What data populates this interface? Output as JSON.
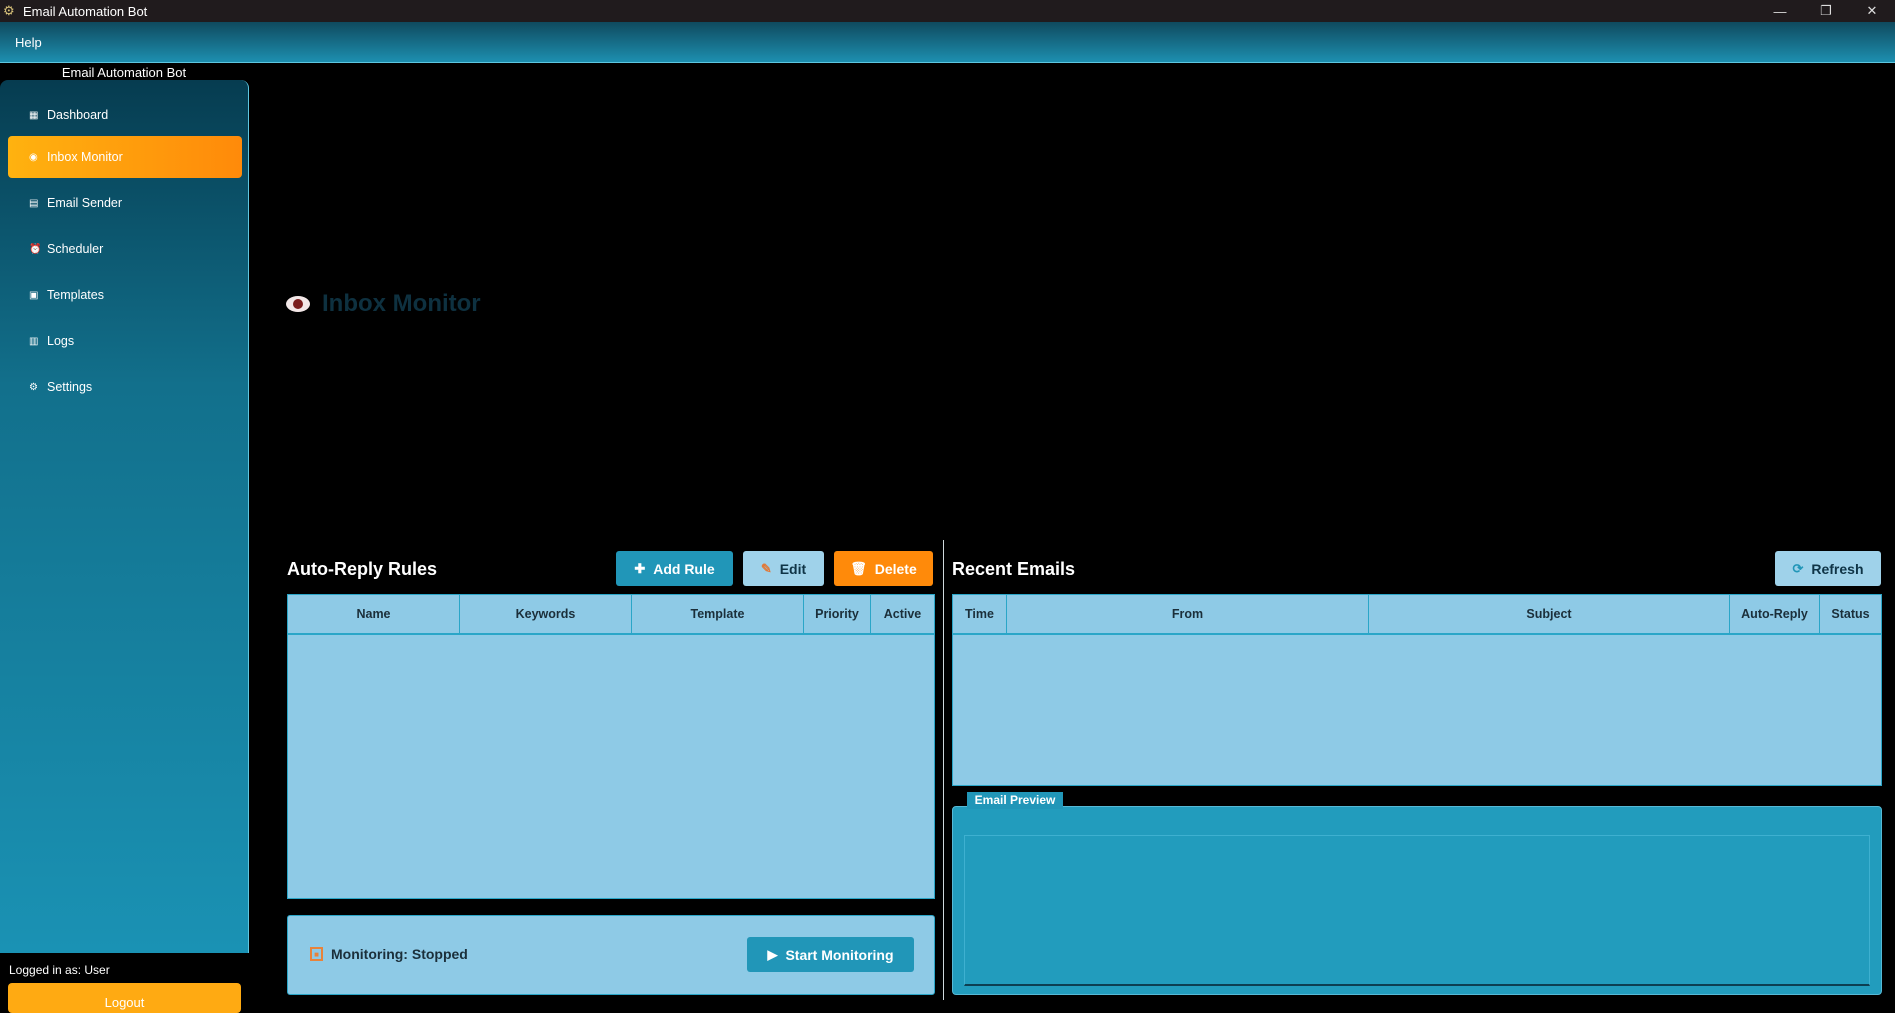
{
  "window": {
    "title": "Email Automation Bot",
    "controls": {
      "minimize": "—",
      "maximize": "❐",
      "close": "✕"
    }
  },
  "menubar": {
    "help": "Help"
  },
  "sidebar": {
    "title": "Email Automation Bot",
    "items": [
      {
        "label": "Dashboard",
        "icon": "chart-icon",
        "glyph": "▦"
      },
      {
        "label": "Inbox Monitor",
        "icon": "eye-icon",
        "glyph": "◉"
      },
      {
        "label": "Email Sender",
        "icon": "mailbox-icon",
        "glyph": "▤"
      },
      {
        "label": "Scheduler",
        "icon": "alarm-clock-icon",
        "glyph": "⏰"
      },
      {
        "label": "Templates",
        "icon": "document-icon",
        "glyph": "▣"
      },
      {
        "label": "Logs",
        "icon": "clipboard-icon",
        "glyph": "▥"
      },
      {
        "label": "Settings",
        "icon": "gear-icon",
        "glyph": "⚙"
      }
    ],
    "active_index": 1,
    "logged_in": "Logged in as: User",
    "logout": "Logout"
  },
  "page": {
    "title": "Inbox Monitor"
  },
  "rules": {
    "title": "Auto-Reply Rules",
    "add_label": "Add Rule",
    "edit_label": "Edit",
    "delete_label": "Delete",
    "columns": [
      "Name",
      "Keywords",
      "Template",
      "Priority",
      "Active"
    ],
    "rows": []
  },
  "monitor": {
    "status": "Monitoring: Stopped",
    "start_label": "Start Monitoring"
  },
  "emails": {
    "title": "Recent Emails",
    "refresh_label": "Refresh",
    "columns": [
      "Time",
      "From",
      "Subject",
      "Auto-Reply",
      "Status"
    ],
    "rows": []
  },
  "preview": {
    "title": "Email Preview",
    "content": ""
  },
  "colors": {
    "accent_orange": "#ff8a0a",
    "accent_teal": "#2196b8",
    "table_bg": "#8ecae6"
  }
}
